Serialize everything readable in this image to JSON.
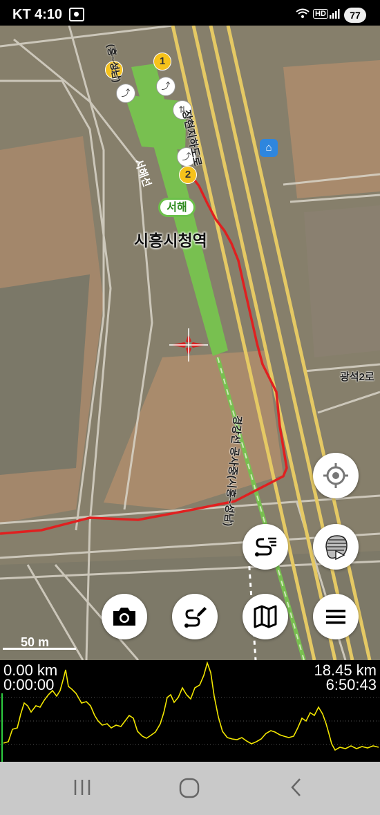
{
  "status_bar": {
    "carrier": "KT",
    "time": "4:10",
    "battery": "77",
    "network_badge": "HD",
    "icons": [
      "screen-record-icon",
      "wifi-icon",
      "signal-icon",
      "battery-icon"
    ]
  },
  "map": {
    "station_name": "시흥시청역",
    "line_badge": "서해",
    "labels": {
      "expressway": "장현지하도로",
      "seohae_line": "서해선",
      "rail_line": "경강선 공사중(시흥~성남)",
      "seohae_top": "(흥~성남)",
      "gwangseok": "광석2로"
    },
    "exit_badges": [
      "1",
      "2",
      "3"
    ],
    "scale_label": "50 m",
    "colors": {
      "track": "#e02020",
      "rail_line": "#7cc44c",
      "badge": "#f6c21b"
    },
    "buttons": {
      "locate": "crosshair-icon",
      "layers": "layers-icon",
      "route": "route-list-icon",
      "camera": "camera-icon",
      "draw_route": "draw-route-icon",
      "map": "map-icon",
      "menu": "menu-icon"
    }
  },
  "elevation": {
    "start_distance": "0.00 km",
    "start_time": "0:00:00",
    "end_distance": "18.45 km",
    "end_time": "6:50:43",
    "profile_color": "#f2e600"
  },
  "nav_bar": {
    "buttons": [
      "recent-apps-icon",
      "home-icon",
      "back-icon"
    ]
  }
}
